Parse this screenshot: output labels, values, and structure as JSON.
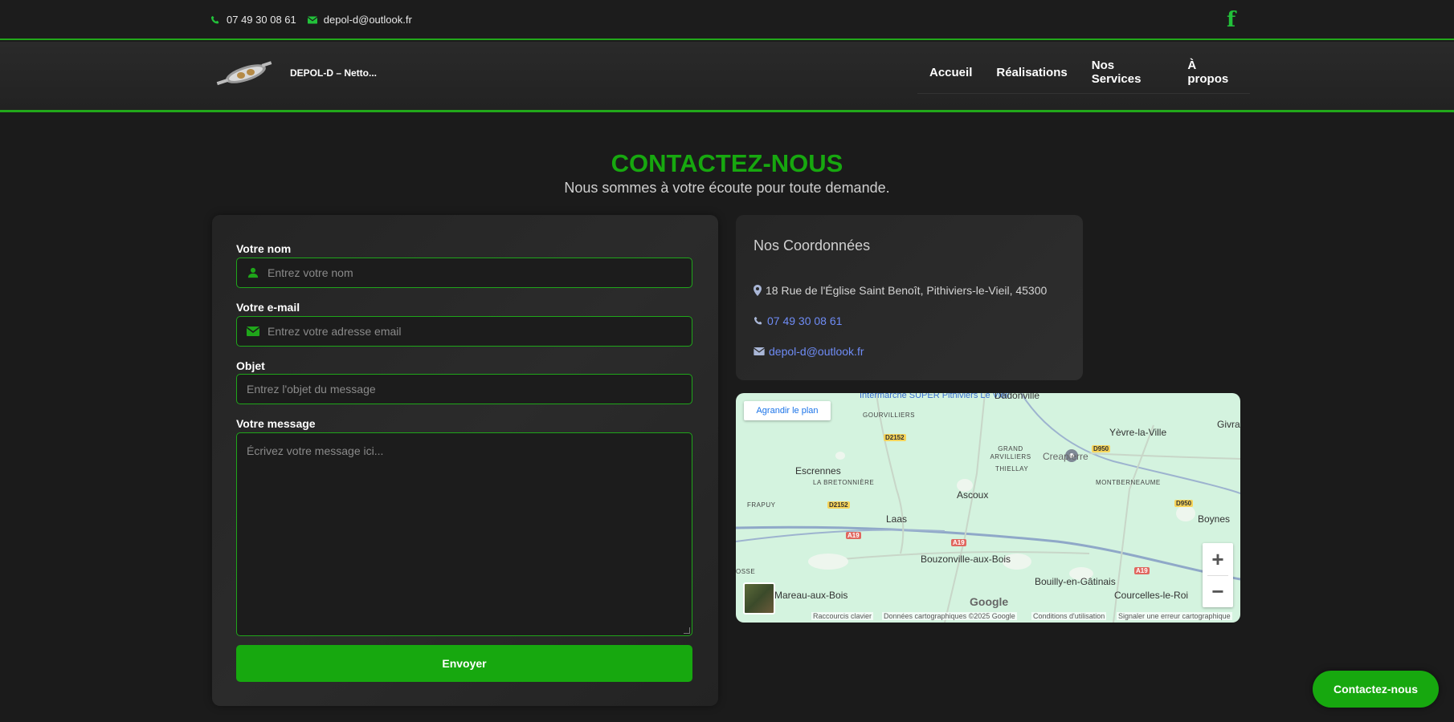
{
  "topbar": {
    "phone": "07 49 30 08 61",
    "email": "depol-d@outlook.fr",
    "social_icon": "facebook-icon"
  },
  "header": {
    "brand": "DEPOL-D – Netto...",
    "nav": [
      "Accueil",
      "Réalisations",
      "Nos Services",
      "À propos"
    ]
  },
  "page": {
    "title": "CONTACTEZ-NOUS",
    "subtitle": "Nous sommes à votre écoute pour toute demande."
  },
  "form": {
    "name_label": "Votre nom",
    "name_placeholder": "Entrez votre nom",
    "email_label": "Votre e-mail",
    "email_placeholder": "Entrez votre adresse email",
    "subject_label": "Objet",
    "subject_placeholder": "Entrez l'objet du message",
    "message_label": "Votre message",
    "message_placeholder": "Écrivez votre message ici...",
    "submit": "Envoyer"
  },
  "coordinates": {
    "title": "Nos Coordonnées",
    "address": "18 Rue de l'Église Saint Benoît, Pithiviers-le-Vieil, 45300",
    "phone": "07 49 30 08 61",
    "email": "depol-d@outlook.fr"
  },
  "map": {
    "enlarge": "Agrandir le plan",
    "places": [
      "Intermarché SUPER Pithiviers Le Vieil",
      "Dadonville",
      "GOURVILLIERS",
      "Yèvre-la-Ville",
      "Givra",
      "GRAND ARVILLIERS",
      "Creapierre",
      "THIELLAY",
      "Escrennes",
      "LA BRETONNIÈRE",
      "MONTBERNEAUME",
      "FRAPUY",
      "Ascoux",
      "Laas",
      "Boynes",
      "Bouzonville-aux-Bois",
      "Bouilly-en-Gâtinais",
      "Courcelles-le-Roi",
      "Mareau-aux-Bois",
      "OSSE"
    ],
    "roads": [
      "D2152",
      "D950",
      "A19"
    ],
    "attribution": [
      "Raccourcis clavier",
      "Données cartographiques ©2025 Google",
      "Conditions d'utilisation",
      "Signaler une erreur cartographique"
    ],
    "logo": "Google"
  },
  "floating_button": "Contactez-nous",
  "colors": {
    "accent": "#17a80f",
    "background": "#1b1b1b",
    "link": "#6f8cf5"
  }
}
